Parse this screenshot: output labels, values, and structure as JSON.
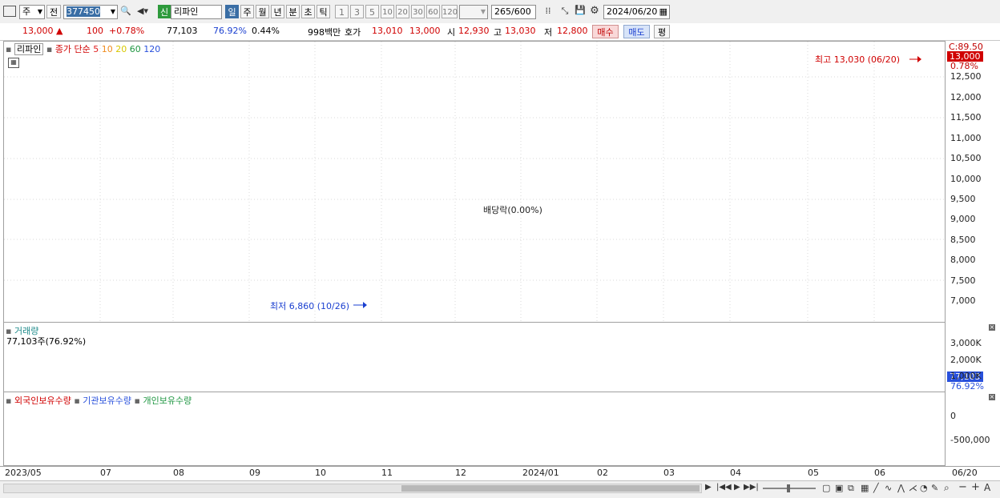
{
  "toolbar": {
    "mode": "주",
    "prev_label": "전",
    "code": "377450",
    "name_badge": "신",
    "name": "리파인",
    "periods": [
      "일",
      "주",
      "월",
      "년",
      "분",
      "초",
      "틱"
    ],
    "selected_period": "일",
    "intervals": [
      "1",
      "3",
      "5",
      "10",
      "20",
      "30",
      "60",
      "120"
    ],
    "count": "265",
    "count_total": "/600",
    "date": "2024/06/20"
  },
  "quote": {
    "price": "13,000",
    "change": "100",
    "change_pct": "+0.78%",
    "volume": "77,103",
    "volume_ratio": "76.92%",
    "turnover_ratio": "0.44%",
    "amount": "998백만",
    "ask_label": "호가",
    "ask": "13,010",
    "bid": "13,000",
    "open_label": "시",
    "open": "12,930",
    "high_label": "고",
    "high": "13,030",
    "low_label": "저",
    "low": "12,800",
    "buy_label": "매수",
    "sell_label": "매도",
    "eval_label": "평"
  },
  "price_pane": {
    "title": "리파인",
    "ma_label": "종가 단순",
    "ma_periods": [
      "5",
      "10",
      "20",
      "60",
      "120"
    ],
    "ma_colors": [
      "#e01e1e",
      "#f08c1e",
      "#f0e020",
      "#1e9641",
      "#2850dc"
    ],
    "axis_top": "C:89.50",
    "current_price": "13,000",
    "current_pct": "0.78%",
    "y_ticks": [
      "12,500",
      "12,000",
      "11,500",
      "11,000",
      "10,500",
      "10,000",
      "9,500",
      "9,000",
      "8,500",
      "8,000",
      "7,500",
      "7,000"
    ],
    "annotation_high": "최고 13,030 (06/20)",
    "annotation_low": "최저 6,860 (10/26)",
    "annotation_dividend": "배당락(0.00%)"
  },
  "volume_pane": {
    "title": "거래량",
    "value": "77,103주(76.92%)",
    "y_ticks": [
      "3,000K",
      "2,000K",
      "1,000K"
    ],
    "current": "77,103",
    "current_pct": "76.92%"
  },
  "holdings_pane": {
    "labels": [
      "외국인보유수량",
      "기관보유수량",
      "개인보유수량"
    ],
    "colors": [
      "#d00000",
      "#2850dc",
      "#1e9641"
    ],
    "y_ticks": [
      "0",
      "-500,000"
    ]
  },
  "x_axis": {
    "ticks": [
      "2023/05",
      "07",
      "08",
      "09",
      "10",
      "11",
      "12",
      "2024/01",
      "02",
      "03",
      "04",
      "05",
      "06"
    ],
    "end_label": "06/20"
  }
}
